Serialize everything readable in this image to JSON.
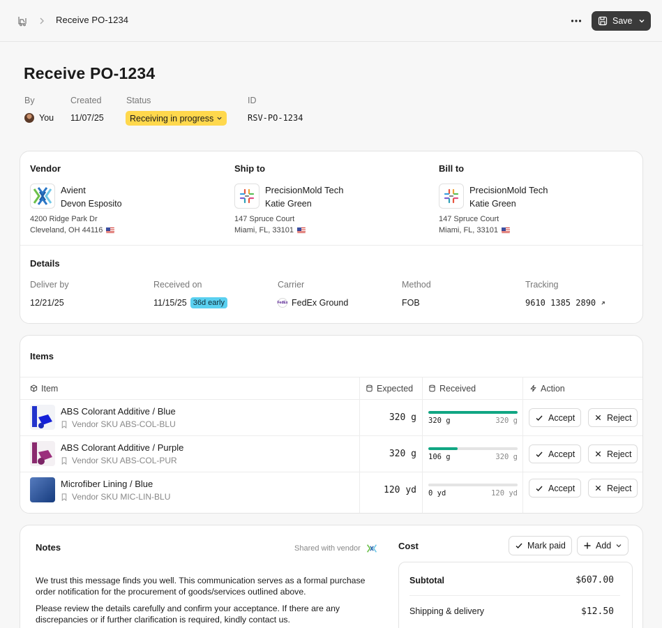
{
  "header": {
    "breadcrumb": "Receive PO-1234",
    "save_label": "Save"
  },
  "page": {
    "title": "Receive PO-1234",
    "meta": {
      "by_label": "By",
      "by_value": "You",
      "created_label": "Created",
      "created_value": "11/07/25",
      "status_label": "Status",
      "status_value": "Receiving in progress",
      "id_label": "ID",
      "id_value": "RSV-PO-1234"
    }
  },
  "parties": {
    "vendor": {
      "heading": "Vendor",
      "name": "Avient",
      "contact": "Devon Esposito",
      "address1": "4200 Ridge Park Dr",
      "address2": "Cleveland, OH 44116"
    },
    "ship_to": {
      "heading": "Ship to",
      "name": "PrecisionMold Tech",
      "contact": "Katie Green",
      "address1": "147 Spruce Court",
      "address2": "Miami, FL, 33101"
    },
    "bill_to": {
      "heading": "Bill to",
      "name": "PrecisionMold Tech",
      "contact": "Katie Green",
      "address1": "147 Spruce Court",
      "address2": "Miami, FL, 33101"
    }
  },
  "details": {
    "heading": "Details",
    "deliver_by_label": "Deliver by",
    "deliver_by": "12/21/25",
    "received_on_label": "Received on",
    "received_on": "11/15/25",
    "early_badge": "36d early",
    "carrier_label": "Carrier",
    "carrier": "FedEx Ground",
    "method_label": "Method",
    "method": "FOB",
    "tracking_label": "Tracking",
    "tracking": "9610 1385 2890"
  },
  "items": {
    "heading": "Items",
    "columns": {
      "item": "Item",
      "expected": "Expected",
      "received": "Received",
      "action": "Action"
    },
    "accept_label": "Accept",
    "reject_label": "Reject",
    "rows": [
      {
        "name": "ABS Colorant Additive / Blue",
        "sku": "Vendor SKU ABS-COL-BLU",
        "expected": "320 g",
        "received": "320 g",
        "received_of": "320 g",
        "progress": 1.0
      },
      {
        "name": "ABS Colorant Additive / Purple",
        "sku": "Vendor SKU ABS-COL-PUR",
        "expected": "320 g",
        "received": "106 g",
        "received_of": "320 g",
        "progress": 0.33
      },
      {
        "name": "Microfiber Lining / Blue",
        "sku": "Vendor SKU MIC-LIN-BLU",
        "expected": "120 yd",
        "received": "0 yd",
        "received_of": "120 yd",
        "progress": 0.0
      }
    ]
  },
  "notes": {
    "heading": "Notes",
    "shared_label": "Shared with vendor",
    "paragraph1": "We trust this message finds you well. This communication serves as a formal purchase order notification for the procurement of goods/services outlined above.",
    "paragraph2": "Please review the details carefully and confirm your acceptance. If there are any discrepancies or if further clarification is required, kindly contact us."
  },
  "cost": {
    "heading": "Cost",
    "mark_paid_label": "Mark paid",
    "add_label": "Add",
    "subtotal_label": "Subtotal",
    "subtotal": "$607.00",
    "shipping_label": "Shipping & delivery",
    "shipping": "$12.50"
  },
  "colors": {
    "status_pill": "#ffd84d",
    "early_badge": "#5ad0f0",
    "progress_fill": "#11a683",
    "save_button": "#3a3a3a"
  }
}
